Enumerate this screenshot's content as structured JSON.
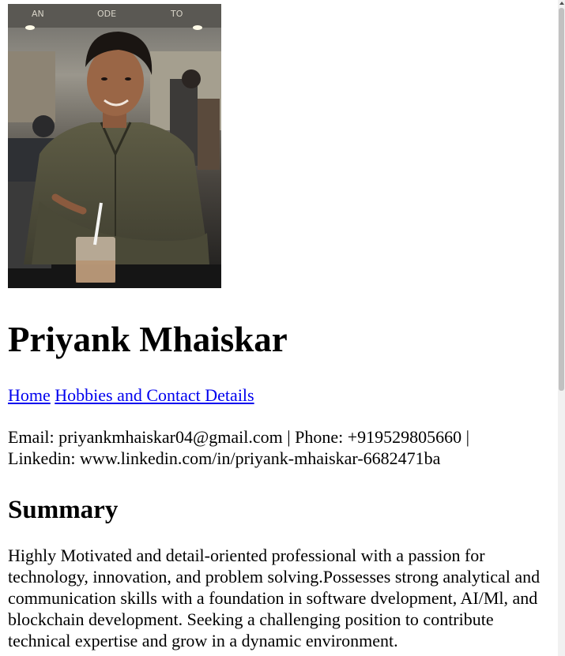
{
  "profile": {
    "photo_alt": "Photo of Priyank Mhaiskar",
    "name": "Priyank Mhaiskar"
  },
  "nav": {
    "links": [
      {
        "label": "Home"
      },
      {
        "label": "Hobbies and Contact Details"
      }
    ]
  },
  "contact": {
    "line1": "Email: priyankmhaiskar04@gmail.com | Phone: +919529805660 |",
    "line2": "Linkedin: www.linkedin.com/in/priyank-mhaiskar-6682471ba"
  },
  "summary": {
    "title": "Summary",
    "text": "Highly Motivated and detail-oriented professional with a passion for technology, innovation, and problem solving.Possesses strong analytical and communication skills with a foundation in software dvelopment, AI/Ml, and blockchain development. Seeking a challenging position to contribute technical expertise and grow in a dynamic environment."
  },
  "colors": {
    "link": "#0000ee",
    "text": "#000000",
    "background": "#ffffff"
  }
}
